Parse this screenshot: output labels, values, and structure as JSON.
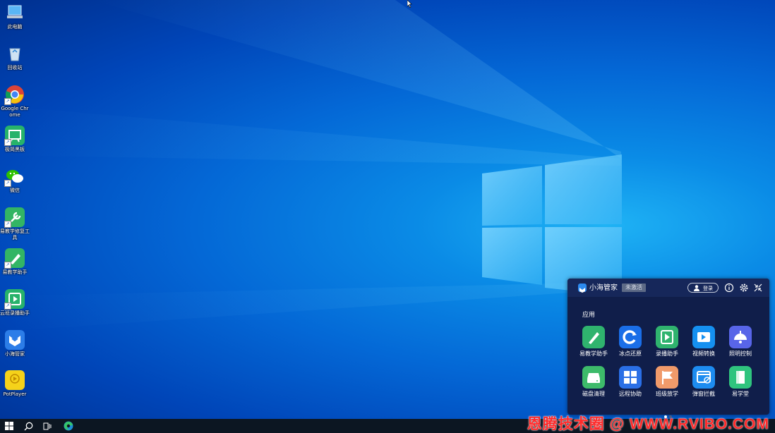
{
  "desktop_icons": [
    {
      "label": "此电脑",
      "icon": "computer-icon"
    },
    {
      "label": "回收站",
      "icon": "recycle-bin-icon"
    },
    {
      "label": "Google Chrome",
      "icon": "chrome-icon"
    },
    {
      "label": "极简黑板",
      "icon": "blackboard-app-icon"
    },
    {
      "label": "微信",
      "icon": "wechat-icon"
    },
    {
      "label": "易教学修复工具",
      "icon": "repair-tool-icon"
    },
    {
      "label": "易教学助手",
      "icon": "teaching-assistant-icon"
    },
    {
      "label": "云班录播助手",
      "icon": "recording-assistant-icon"
    },
    {
      "label": "小海管家",
      "icon": "xiaohai-manager-icon"
    },
    {
      "label": "PotPlayer",
      "icon": "potplayer-icon"
    }
  ],
  "taskbar": {
    "items": [
      {
        "name": "start-button",
        "icon": "windows-logo-icon"
      },
      {
        "name": "search-button",
        "icon": "search-icon"
      },
      {
        "name": "task-view-button",
        "icon": "task-view-icon"
      },
      {
        "name": "edge-button",
        "icon": "edge-icon"
      }
    ]
  },
  "watermark": "恩腾技术圈 @ WWW.RVIBO.COM",
  "panel": {
    "title": "小海管家",
    "status": "未激活",
    "login_label": "登录",
    "header_icons": [
      "info-icon",
      "settings-icon",
      "collapse-icon"
    ],
    "section_label": "应用",
    "apps": [
      {
        "label": "易教学助手",
        "icon": "pen-icon",
        "color": "#2fb36e"
      },
      {
        "label": "冰点还原",
        "icon": "restore-icon",
        "color": "#1a6ee8"
      },
      {
        "label": "录播助手",
        "icon": "record-icon",
        "color": "#2fb36e"
      },
      {
        "label": "视频转换",
        "icon": "video-convert-icon",
        "color": "#1590f0"
      },
      {
        "label": "照明控制",
        "icon": "lamp-icon",
        "color": "#5865e8"
      },
      {
        "label": "磁盘清理",
        "icon": "disk-icon",
        "color": "#3dbb6a"
      },
      {
        "label": "远程协助",
        "icon": "remote-icon",
        "color": "#2a6fe6"
      },
      {
        "label": "班级放学",
        "icon": "flag-icon",
        "color": "#f09a6a"
      },
      {
        "label": "弹窗拦截",
        "icon": "popup-block-icon",
        "color": "#1d8cf0"
      },
      {
        "label": "易学堂",
        "icon": "book-icon",
        "color": "#2fc47e"
      }
    ],
    "page_dots": 2,
    "active_page": 1
  },
  "colors": {
    "panel_bg": "#101e4a",
    "panel_header": "#16275a",
    "taskbar": "#0c1622",
    "watermark": "#ff2a2a"
  }
}
